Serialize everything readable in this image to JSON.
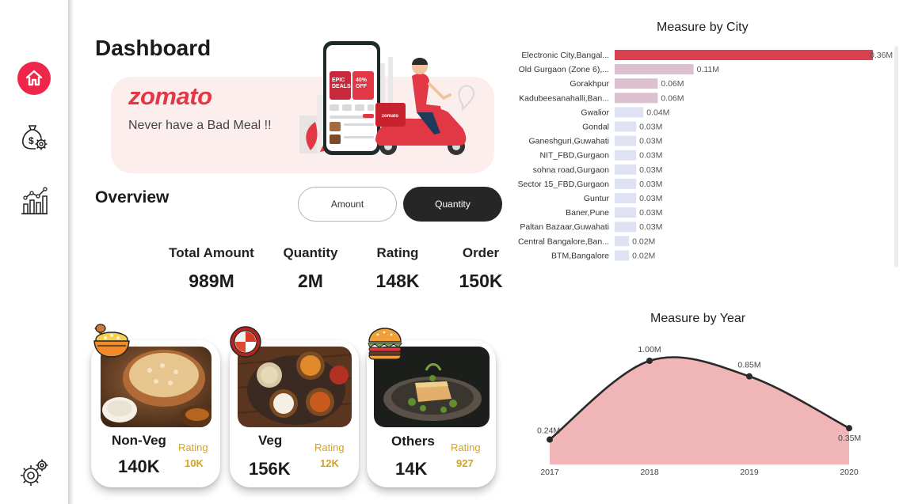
{
  "sidebar": {
    "items": [
      {
        "name": "home",
        "icon": "home-icon"
      },
      {
        "name": "money",
        "icon": "money-bag-gear-icon"
      },
      {
        "name": "analytics",
        "icon": "bar-chart-icon"
      },
      {
        "name": "settings",
        "icon": "gear-icon"
      }
    ]
  },
  "header": {
    "title": "Dashboard"
  },
  "banner": {
    "brand": "zomato",
    "tagline": "Never have a Bad Meal !!",
    "phone_text": [
      "EPIC",
      "DEALS",
      "40%",
      "OFF"
    ]
  },
  "overview": {
    "title": "Overview",
    "toggle": {
      "amount_label": "Amount",
      "quantity_label": "Quantity",
      "selected": "Quantity"
    }
  },
  "kpis": [
    {
      "label": "Total Amount",
      "value": "989M"
    },
    {
      "label": "Quantity",
      "value": "2M"
    },
    {
      "label": "Rating",
      "value": "148K"
    },
    {
      "label": "Order",
      "value": "150K"
    }
  ],
  "cards": [
    {
      "name": "Non-Veg",
      "count": "140K",
      "rating_label": "Rating",
      "rating_value": "10K",
      "icon": "biryani-icon"
    },
    {
      "name": "Veg",
      "count": "156K",
      "rating_label": "Rating",
      "rating_value": "12K",
      "icon": "thali-icon"
    },
    {
      "name": "Others",
      "count": "14K",
      "rating_label": "Rating",
      "rating_value": "927",
      "icon": "burger-icon"
    }
  ],
  "colors": {
    "accent": "#e23744",
    "brand_red": "#f0254a",
    "dark": "#262626",
    "area_fill": "#f0b5b7",
    "rating_gold": "#d4a21b"
  },
  "chart_data": [
    {
      "type": "bar",
      "orientation": "horizontal",
      "title": "Measure by City",
      "categories": [
        "Electronic City,Bangal...",
        "Old Gurgaon (Zone 6),...",
        "Gorakhpur",
        "Kadubeesanahalli,Ban...",
        "Gwalior",
        "Gondal",
        "Ganeshguri,Guwahati",
        "NIT_FBD,Gurgaon",
        "sohna road,Gurgaon",
        "Sector 15_FBD,Gurgaon",
        "Guntur",
        "Baner,Pune",
        "Paltan Bazaar,Guwahati",
        "Central Bangalore,Ban...",
        "BTM,Bangalore"
      ],
      "values": [
        0.36,
        0.11,
        0.06,
        0.06,
        0.04,
        0.03,
        0.03,
        0.03,
        0.03,
        0.03,
        0.03,
        0.03,
        0.03,
        0.02,
        0.02
      ],
      "labels": [
        "0.36M",
        "0.11M",
        "0.06M",
        "0.06M",
        "0.04M",
        "0.03M",
        "0.03M",
        "0.03M",
        "0.03M",
        "0.03M",
        "0.03M",
        "0.03M",
        "0.03M",
        "0.02M",
        "0.02M"
      ],
      "unit": "M"
    },
    {
      "type": "area",
      "title": "Measure by Year",
      "x": [
        "2017",
        "2018",
        "2019",
        "2020"
      ],
      "values": [
        0.24,
        1.0,
        0.85,
        0.35
      ],
      "labels": [
        "0.24M",
        "1.00M",
        "0.85M",
        "0.35M"
      ],
      "unit": "M"
    }
  ]
}
